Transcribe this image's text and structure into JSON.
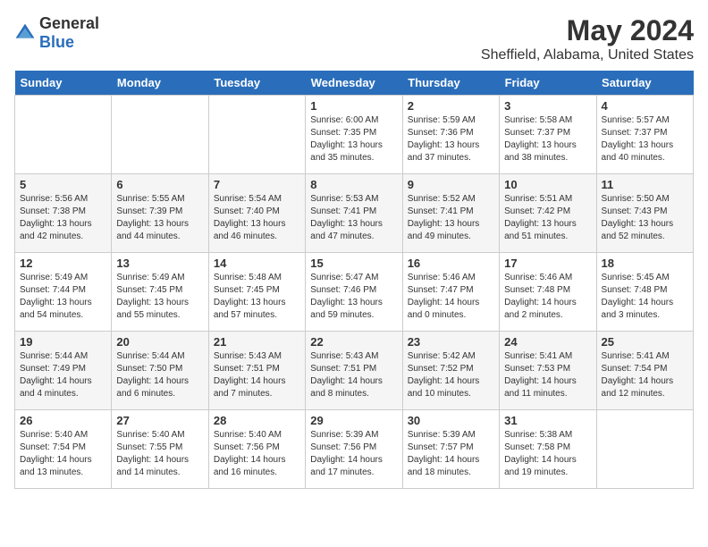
{
  "logo": {
    "general": "General",
    "blue": "Blue"
  },
  "title": "May 2024",
  "subtitle": "Sheffield, Alabama, United States",
  "days_of_week": [
    "Sunday",
    "Monday",
    "Tuesday",
    "Wednesday",
    "Thursday",
    "Friday",
    "Saturday"
  ],
  "weeks": [
    [
      {
        "day": "",
        "info": ""
      },
      {
        "day": "",
        "info": ""
      },
      {
        "day": "",
        "info": ""
      },
      {
        "day": "1",
        "info": "Sunrise: 6:00 AM\nSunset: 7:35 PM\nDaylight: 13 hours\nand 35 minutes."
      },
      {
        "day": "2",
        "info": "Sunrise: 5:59 AM\nSunset: 7:36 PM\nDaylight: 13 hours\nand 37 minutes."
      },
      {
        "day": "3",
        "info": "Sunrise: 5:58 AM\nSunset: 7:37 PM\nDaylight: 13 hours\nand 38 minutes."
      },
      {
        "day": "4",
        "info": "Sunrise: 5:57 AM\nSunset: 7:37 PM\nDaylight: 13 hours\nand 40 minutes."
      }
    ],
    [
      {
        "day": "5",
        "info": "Sunrise: 5:56 AM\nSunset: 7:38 PM\nDaylight: 13 hours\nand 42 minutes."
      },
      {
        "day": "6",
        "info": "Sunrise: 5:55 AM\nSunset: 7:39 PM\nDaylight: 13 hours\nand 44 minutes."
      },
      {
        "day": "7",
        "info": "Sunrise: 5:54 AM\nSunset: 7:40 PM\nDaylight: 13 hours\nand 46 minutes."
      },
      {
        "day": "8",
        "info": "Sunrise: 5:53 AM\nSunset: 7:41 PM\nDaylight: 13 hours\nand 47 minutes."
      },
      {
        "day": "9",
        "info": "Sunrise: 5:52 AM\nSunset: 7:41 PM\nDaylight: 13 hours\nand 49 minutes."
      },
      {
        "day": "10",
        "info": "Sunrise: 5:51 AM\nSunset: 7:42 PM\nDaylight: 13 hours\nand 51 minutes."
      },
      {
        "day": "11",
        "info": "Sunrise: 5:50 AM\nSunset: 7:43 PM\nDaylight: 13 hours\nand 52 minutes."
      }
    ],
    [
      {
        "day": "12",
        "info": "Sunrise: 5:49 AM\nSunset: 7:44 PM\nDaylight: 13 hours\nand 54 minutes."
      },
      {
        "day": "13",
        "info": "Sunrise: 5:49 AM\nSunset: 7:45 PM\nDaylight: 13 hours\nand 55 minutes."
      },
      {
        "day": "14",
        "info": "Sunrise: 5:48 AM\nSunset: 7:45 PM\nDaylight: 13 hours\nand 57 minutes."
      },
      {
        "day": "15",
        "info": "Sunrise: 5:47 AM\nSunset: 7:46 PM\nDaylight: 13 hours\nand 59 minutes."
      },
      {
        "day": "16",
        "info": "Sunrise: 5:46 AM\nSunset: 7:47 PM\nDaylight: 14 hours\nand 0 minutes."
      },
      {
        "day": "17",
        "info": "Sunrise: 5:46 AM\nSunset: 7:48 PM\nDaylight: 14 hours\nand 2 minutes."
      },
      {
        "day": "18",
        "info": "Sunrise: 5:45 AM\nSunset: 7:48 PM\nDaylight: 14 hours\nand 3 minutes."
      }
    ],
    [
      {
        "day": "19",
        "info": "Sunrise: 5:44 AM\nSunset: 7:49 PM\nDaylight: 14 hours\nand 4 minutes."
      },
      {
        "day": "20",
        "info": "Sunrise: 5:44 AM\nSunset: 7:50 PM\nDaylight: 14 hours\nand 6 minutes."
      },
      {
        "day": "21",
        "info": "Sunrise: 5:43 AM\nSunset: 7:51 PM\nDaylight: 14 hours\nand 7 minutes."
      },
      {
        "day": "22",
        "info": "Sunrise: 5:43 AM\nSunset: 7:51 PM\nDaylight: 14 hours\nand 8 minutes."
      },
      {
        "day": "23",
        "info": "Sunrise: 5:42 AM\nSunset: 7:52 PM\nDaylight: 14 hours\nand 10 minutes."
      },
      {
        "day": "24",
        "info": "Sunrise: 5:41 AM\nSunset: 7:53 PM\nDaylight: 14 hours\nand 11 minutes."
      },
      {
        "day": "25",
        "info": "Sunrise: 5:41 AM\nSunset: 7:54 PM\nDaylight: 14 hours\nand 12 minutes."
      }
    ],
    [
      {
        "day": "26",
        "info": "Sunrise: 5:40 AM\nSunset: 7:54 PM\nDaylight: 14 hours\nand 13 minutes."
      },
      {
        "day": "27",
        "info": "Sunrise: 5:40 AM\nSunset: 7:55 PM\nDaylight: 14 hours\nand 14 minutes."
      },
      {
        "day": "28",
        "info": "Sunrise: 5:40 AM\nSunset: 7:56 PM\nDaylight: 14 hours\nand 16 minutes."
      },
      {
        "day": "29",
        "info": "Sunrise: 5:39 AM\nSunset: 7:56 PM\nDaylight: 14 hours\nand 17 minutes."
      },
      {
        "day": "30",
        "info": "Sunrise: 5:39 AM\nSunset: 7:57 PM\nDaylight: 14 hours\nand 18 minutes."
      },
      {
        "day": "31",
        "info": "Sunrise: 5:38 AM\nSunset: 7:58 PM\nDaylight: 14 hours\nand 19 minutes."
      },
      {
        "day": "",
        "info": ""
      }
    ]
  ]
}
